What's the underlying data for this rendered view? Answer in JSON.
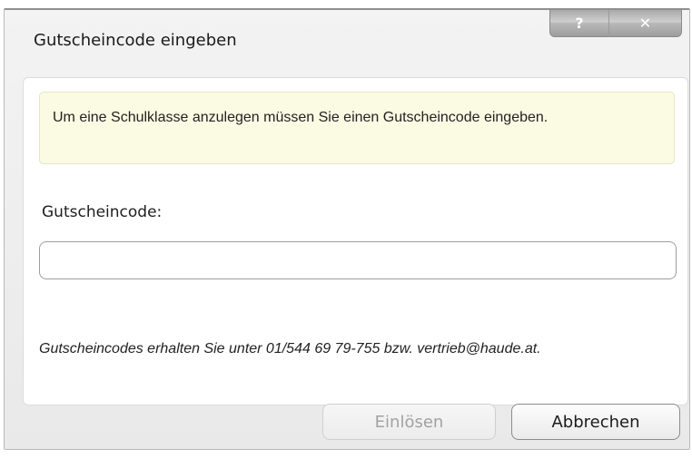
{
  "dialog": {
    "title": "Gutscheincode eingeben",
    "help_button": "?",
    "close_button": "✕",
    "notice": "Um eine Schulklasse anzulegen müssen Sie einen Gutscheincode eingeben.",
    "field_label": "Gutscheincode:",
    "field_value": "",
    "hint": "Gutscheincodes erhalten Sie unter 01/544 69 79-755 bzw. vertrieb@haude.at.",
    "buttons": {
      "redeem": "Einlösen",
      "cancel": "Abbrechen"
    },
    "button_states": {
      "redeem": "disabled",
      "cancel": "enabled"
    }
  },
  "colors": {
    "notice_background": "#fbfbe3",
    "dialog_background": "#f0f0f0",
    "disabled_text": "#a2a2a2"
  },
  "icons": {
    "help": "help-icon",
    "close": "close-icon"
  }
}
